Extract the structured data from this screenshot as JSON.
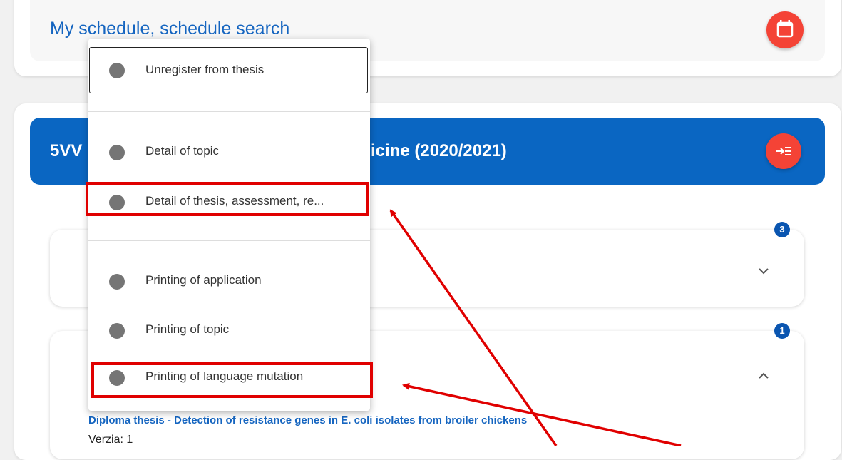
{
  "schedule": {
    "link_label": "My schedule, schedule search",
    "icon": "calendar-icon"
  },
  "course": {
    "title_left": "5VV",
    "title_right": "icine (2020/2021)",
    "expand_icon": "arrow-list-icon"
  },
  "badges": [
    "3",
    "1"
  ],
  "thesis": {
    "title": "Diploma thesis - Detection of resistance genes in E. coli isolates from broiler chickens",
    "version": "Verzia: 1"
  },
  "menu": {
    "items": [
      {
        "label": "Unregister from thesis"
      },
      {
        "label": "Detail of topic"
      },
      {
        "label": "Detail of thesis, assessment, re..."
      },
      {
        "label": "Printing of application"
      },
      {
        "label": "Printing of topic"
      },
      {
        "label": "Printing of language mutation"
      }
    ]
  },
  "colors": {
    "accent_blue": "#0a66c2",
    "fab_red": "#f44336",
    "annotation_red": "#e00000"
  }
}
